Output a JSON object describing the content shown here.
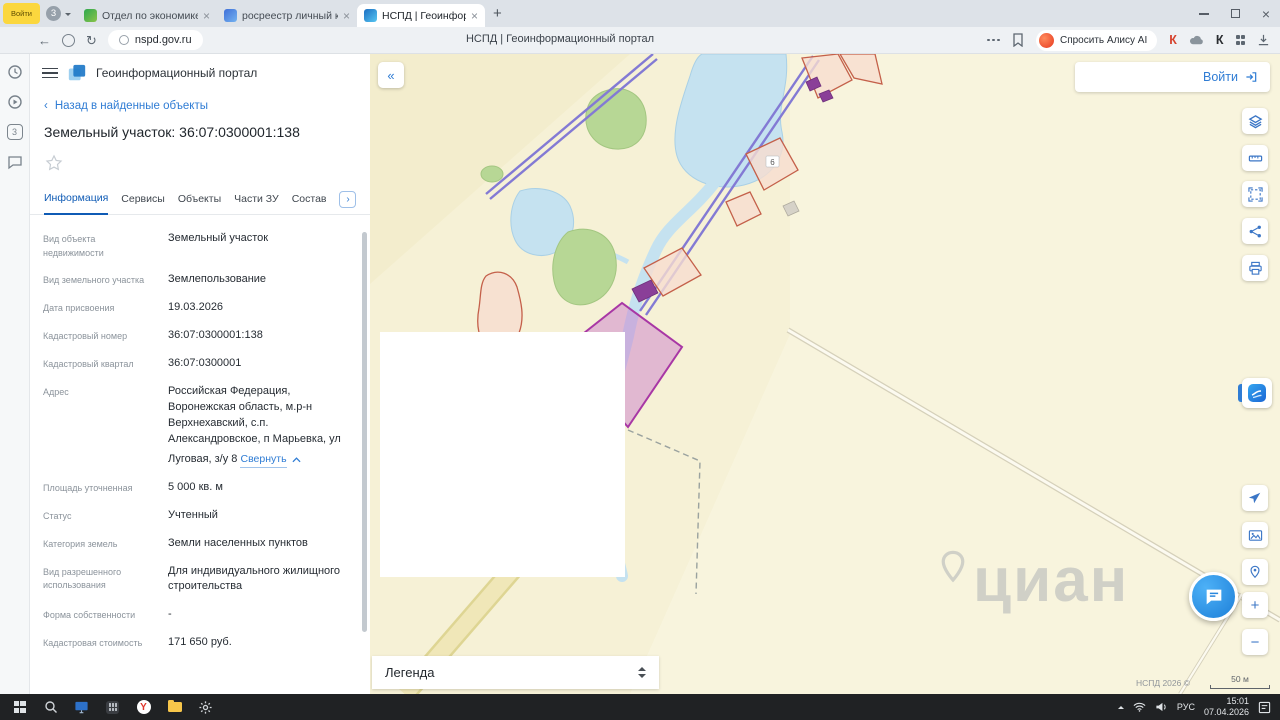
{
  "icons": {
    "back_arrow": "←",
    "refresh": "↻",
    "collapse_panel": "«",
    "chevron_left": "‹",
    "chevron_right": "›",
    "new_tab": "+",
    "close": "×",
    "zoom_in": "+",
    "zoom_out": "−"
  },
  "browser": {
    "profile_button": "Войти",
    "tab_badge": "3",
    "tabs": [
      {
        "title": "Отдел по экономике и уп"
      },
      {
        "title": "росреестр личный кабин"
      },
      {
        "title": "НСПД | Геоинформац"
      }
    ],
    "address": "nspd.gov.ru",
    "page_title": "НСПД | Геоинформационный портал",
    "alice_button": "Спросить Алису AI",
    "k_icon_1": "К",
    "k_icon_2": "К"
  },
  "sidebar": {
    "badge": "3"
  },
  "panel": {
    "brand": "Геоинформационный портал",
    "back_link": "Назад в найденные объекты",
    "title": "Земельный участок: 36:07:0300001:138",
    "tabs": [
      "Информация",
      "Сервисы",
      "Объекты",
      "Части ЗУ",
      "Состав"
    ],
    "fields": [
      {
        "label": "Вид объекта недвижимости",
        "value": "Земельный участок"
      },
      {
        "label": "Вид земельного участка",
        "value": "Землепользование"
      },
      {
        "label": "Дата присвоения",
        "value": "19.03.2026"
      },
      {
        "label": "Кадастровый номер",
        "value": "36:07:0300001:138"
      },
      {
        "label": "Кадастровый квартал",
        "value": "36:07:0300001"
      },
      {
        "label": "Адрес",
        "value": "Российская Федерация, Воронежская область, м.р-н Верхнехавский, с.п. Александровское, п Марьевка, ул Луговая, з/у 8",
        "link_label": "Свернуть"
      },
      {
        "label": "Площадь уточненная",
        "value": "5 000 кв. м"
      },
      {
        "label": "Статус",
        "value": "Учтенный"
      },
      {
        "label": "Категория земель",
        "value": "Земли населенных пунктов"
      },
      {
        "label": "Вид разрешенного использования",
        "value": "Для индивидуального жилищного строительства"
      },
      {
        "label": "Форма собственности",
        "value": "-"
      },
      {
        "label": "Кадастровая стоимость",
        "value": "171 650 руб."
      }
    ]
  },
  "map": {
    "login_button": "Войти",
    "legend_title": "Легенда",
    "copyright": "НСПД 2026 ©",
    "scale_label": "50 м",
    "watermark": "циан",
    "parcel_number": "6",
    "colors": {
      "selected_parcel_fill": "#cb7fcb",
      "selected_parcel_stroke": "#a837a5",
      "water": "#c5e2f0",
      "vegetation": "#b7d795",
      "highway": "#837ad4",
      "parcel_outline": "#c4604a",
      "accent_blue": "#2f7cd4"
    }
  },
  "taskbar": {
    "time": "15:01",
    "date": "07.04.2026",
    "lang": "РУС"
  }
}
